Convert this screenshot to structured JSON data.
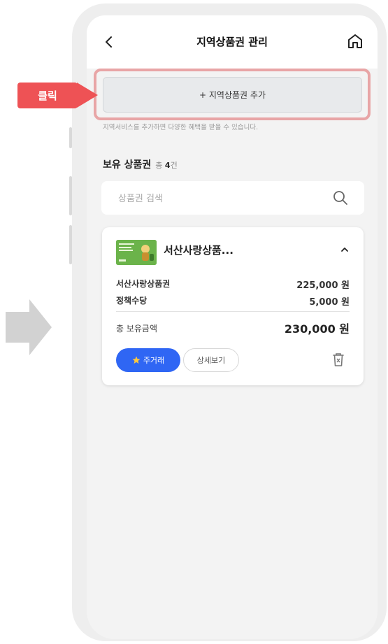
{
  "header": {
    "title": "지역상품권 관리",
    "back_icon": "chevron-left-icon",
    "home_icon": "home-icon"
  },
  "annotation": {
    "click_label": "클릭",
    "color": "#ee5255",
    "highlight_color": "#e8a5a6"
  },
  "add_button": {
    "label": "+ 지역상품권 추가"
  },
  "notice": "지역서비스를 추가하면 다양한 혜택을 받을 수 있습니다.",
  "holdings": {
    "title": "보유 상품권",
    "count_prefix": "총",
    "count": "4",
    "count_suffix": "건"
  },
  "search": {
    "placeholder": "상품권 검색",
    "icon": "search-icon"
  },
  "card": {
    "name": "서산사랑상품...",
    "thumb_color": "#6bb34a",
    "items": [
      {
        "label": "서산사랑상품권",
        "amount": "225,000 원"
      },
      {
        "label": "정책수당",
        "amount": "5,000 원"
      }
    ],
    "total_label": "총 보유금액",
    "total_amount": "230,000 원",
    "favorite_label": "주거래",
    "detail_label": "상세보기"
  },
  "colors": {
    "primary": "#2f66f4",
    "background": "#f3f3f3"
  }
}
